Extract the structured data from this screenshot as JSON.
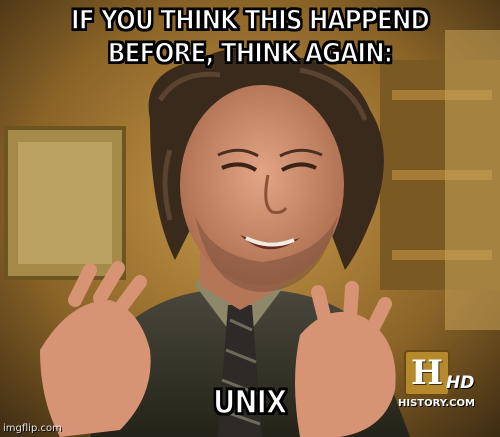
{
  "meme": {
    "top_caption_lines": [
      "IF YOU THINK THIS HAPPEND",
      "BEFORE, THINK AGAIN:"
    ],
    "bottom_caption": "UNIX",
    "channel_logo_letter": "H",
    "channel_logo_hd": "HD",
    "channel_url": "HISTORY.COM",
    "watermark": "imgflip.com"
  },
  "colors": {
    "caption_fill": "#ffffff",
    "caption_outline": "#000000",
    "background_wall": "#b58a3c",
    "suit": "#3b3a30",
    "logo_gold": "#b48a2c"
  },
  "icons": {
    "channel_logo": "history-channel-logo"
  }
}
